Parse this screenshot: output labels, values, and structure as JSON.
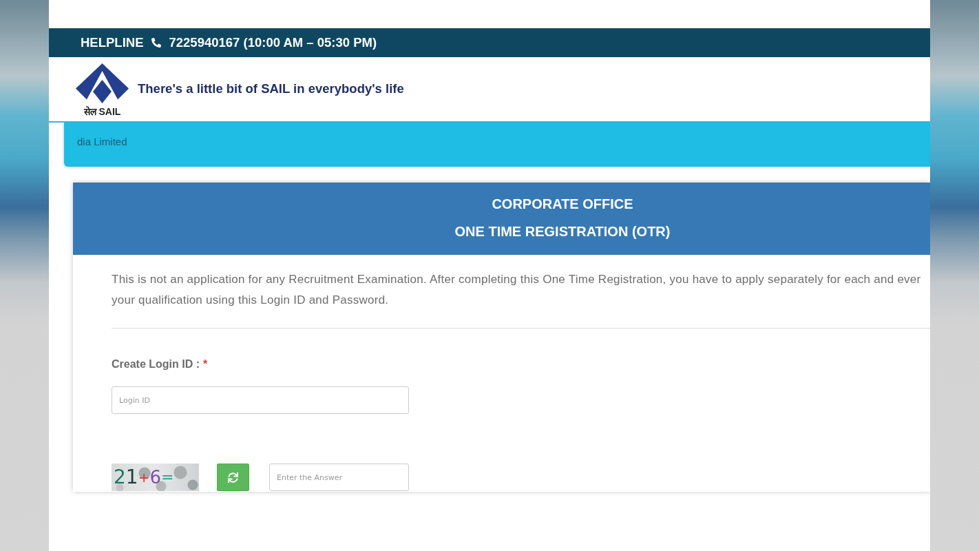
{
  "helpline": {
    "label": "HELPLINE",
    "phone": "7225940167 (10:00 AM – 05:30 PM)"
  },
  "header": {
    "logo_text": "सेल SAIL",
    "tagline": "There's a little bit of SAIL in everybody's life"
  },
  "marquee": {
    "text": "dia Limited"
  },
  "registration": {
    "titles": [
      "CORPORATE OFFICE",
      "ONE TIME REGISTRATION (OTR)"
    ],
    "intro_lines": [
      "This is not an application for any Recruitment Examination. After completing this One Time Registration, you have to apply separately for each and ever",
      "your qualification using this Login ID and Password."
    ],
    "login_field": {
      "label": "Create Login ID :",
      "required_mark": "*",
      "placeholder": "Login ID"
    },
    "captcha": {
      "text": "21+6=",
      "answer_placeholder": "Enter the Answer"
    }
  }
}
